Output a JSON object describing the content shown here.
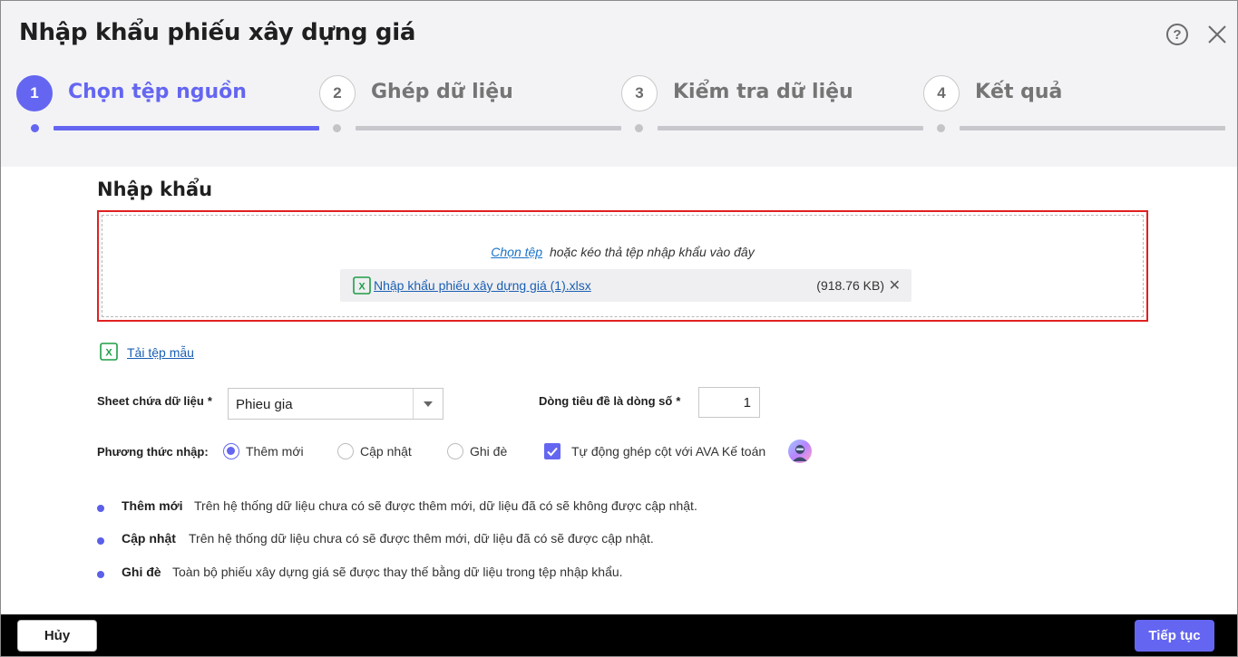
{
  "dialog": {
    "title": "Nhập khẩu phiếu xây dựng giá",
    "help_icon": "help-icon",
    "close_icon": "close-icon"
  },
  "steps": [
    {
      "number": "1",
      "label": "Chọn tệp nguồn",
      "active": true
    },
    {
      "number": "2",
      "label": "Ghép dữ liệu",
      "active": false
    },
    {
      "number": "3",
      "label": "Kiểm tra dữ liệu",
      "active": false
    },
    {
      "number": "4",
      "label": "Kết quả",
      "active": false
    }
  ],
  "import": {
    "section_title": "Nhập khẩu",
    "choose_file_link": "Chọn tệp",
    "drop_hint": "hoặc kéo thả tệp nhập khẩu vào đây",
    "file_name": "Nhập khẩu phiếu xây dựng giá (1).xlsx",
    "file_size": "(918.76 KB)",
    "remove_glyph": "✕",
    "template_link": "Tải tệp mẫu"
  },
  "form": {
    "sheet_label": "Sheet chứa dữ liệu",
    "sheet_value": "Phieu gia",
    "header_row_label": "Dòng tiêu đề là dòng số",
    "header_row_value": "1",
    "required_mark": "*",
    "method_label": "Phương thức nhập:",
    "methods": [
      {
        "label": "Thêm mới",
        "checked": true
      },
      {
        "label": "Cập nhật",
        "checked": false
      },
      {
        "label": "Ghi đè",
        "checked": false
      }
    ],
    "auto_match_label": "Tự động ghép cột với AVA Kế toán",
    "auto_match_checked": true
  },
  "descriptions": [
    {
      "title": "Thêm mới",
      "text": "Trên hệ thống dữ liệu chưa có sẽ được thêm mới, dữ liệu đã có sẽ không được cập nhật."
    },
    {
      "title": "Cập nhật",
      "text": "Trên hệ thống dữ liệu chưa có sẽ được thêm mới, dữ liệu đã có sẽ được cập nhật."
    },
    {
      "title": "Ghi đè",
      "text": "Toàn bộ phiếu xây dựng giá sẽ được thay thế bằng dữ liệu trong tệp nhập khẩu."
    }
  ],
  "footer": {
    "cancel_label": "Hủy",
    "next_label": "Tiếp tục"
  },
  "colors": {
    "accent": "#6466f1",
    "excel_green": "#1e9e47",
    "error_border": "#e02020",
    "link": "#1a5fb4"
  }
}
